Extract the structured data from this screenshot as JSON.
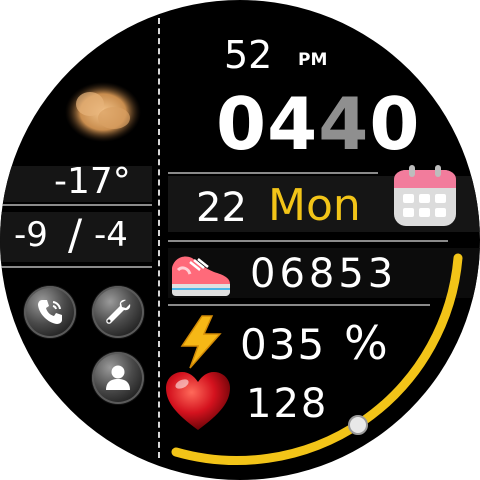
{
  "time": {
    "seconds": "52",
    "ampm": "PM",
    "hour": "04",
    "minute_first": "4",
    "minute_second": "0"
  },
  "date": {
    "day": "22",
    "weekday": "Mon"
  },
  "weather": {
    "current_temp": "-17°",
    "low": "-9",
    "separator": "/",
    "high": "-4"
  },
  "steps": {
    "count": "06853"
  },
  "battery": {
    "value": "035",
    "unit": "%",
    "progress_percent": 35
  },
  "heart": {
    "rate": "128"
  },
  "colors": {
    "accent_yellow": "#f2c418",
    "background": "#000000",
    "text": "#ffffff",
    "band": "#151515"
  },
  "icons": {
    "weather": "dust-cloud-icon",
    "calendar": "calendar-icon",
    "steps": "sneaker-icon",
    "battery": "lightning-bolt-icon",
    "heart": "heart-icon",
    "phone": "phone-icon",
    "settings": "wrench-icon",
    "contacts": "person-icon"
  }
}
